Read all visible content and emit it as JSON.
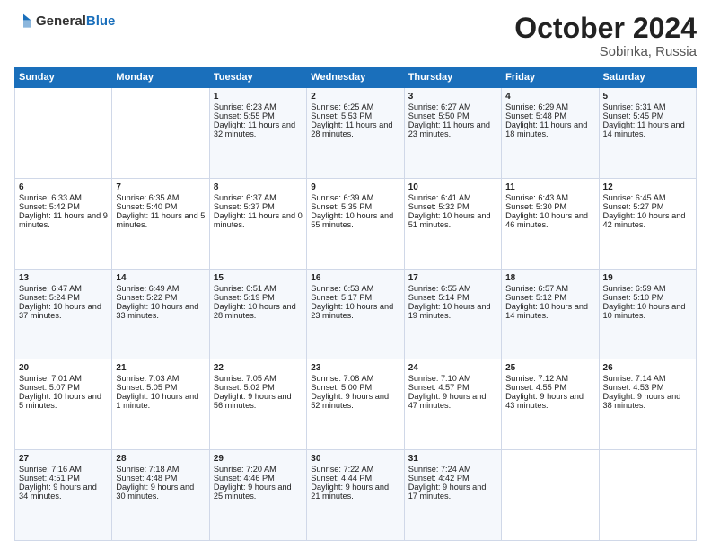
{
  "logo": {
    "general": "General",
    "blue": "Blue"
  },
  "title": {
    "month": "October 2024",
    "location": "Sobinka, Russia"
  },
  "header": {
    "days": [
      "Sunday",
      "Monday",
      "Tuesday",
      "Wednesday",
      "Thursday",
      "Friday",
      "Saturday"
    ]
  },
  "weeks": [
    [
      {
        "day": "",
        "sunrise": "",
        "sunset": "",
        "daylight": ""
      },
      {
        "day": "",
        "sunrise": "",
        "sunset": "",
        "daylight": ""
      },
      {
        "day": "1",
        "sunrise": "Sunrise: 6:23 AM",
        "sunset": "Sunset: 5:55 PM",
        "daylight": "Daylight: 11 hours and 32 minutes."
      },
      {
        "day": "2",
        "sunrise": "Sunrise: 6:25 AM",
        "sunset": "Sunset: 5:53 PM",
        "daylight": "Daylight: 11 hours and 28 minutes."
      },
      {
        "day": "3",
        "sunrise": "Sunrise: 6:27 AM",
        "sunset": "Sunset: 5:50 PM",
        "daylight": "Daylight: 11 hours and 23 minutes."
      },
      {
        "day": "4",
        "sunrise": "Sunrise: 6:29 AM",
        "sunset": "Sunset: 5:48 PM",
        "daylight": "Daylight: 11 hours and 18 minutes."
      },
      {
        "day": "5",
        "sunrise": "Sunrise: 6:31 AM",
        "sunset": "Sunset: 5:45 PM",
        "daylight": "Daylight: 11 hours and 14 minutes."
      }
    ],
    [
      {
        "day": "6",
        "sunrise": "Sunrise: 6:33 AM",
        "sunset": "Sunset: 5:42 PM",
        "daylight": "Daylight: 11 hours and 9 minutes."
      },
      {
        "day": "7",
        "sunrise": "Sunrise: 6:35 AM",
        "sunset": "Sunset: 5:40 PM",
        "daylight": "Daylight: 11 hours and 5 minutes."
      },
      {
        "day": "8",
        "sunrise": "Sunrise: 6:37 AM",
        "sunset": "Sunset: 5:37 PM",
        "daylight": "Daylight: 11 hours and 0 minutes."
      },
      {
        "day": "9",
        "sunrise": "Sunrise: 6:39 AM",
        "sunset": "Sunset: 5:35 PM",
        "daylight": "Daylight: 10 hours and 55 minutes."
      },
      {
        "day": "10",
        "sunrise": "Sunrise: 6:41 AM",
        "sunset": "Sunset: 5:32 PM",
        "daylight": "Daylight: 10 hours and 51 minutes."
      },
      {
        "day": "11",
        "sunrise": "Sunrise: 6:43 AM",
        "sunset": "Sunset: 5:30 PM",
        "daylight": "Daylight: 10 hours and 46 minutes."
      },
      {
        "day": "12",
        "sunrise": "Sunrise: 6:45 AM",
        "sunset": "Sunset: 5:27 PM",
        "daylight": "Daylight: 10 hours and 42 minutes."
      }
    ],
    [
      {
        "day": "13",
        "sunrise": "Sunrise: 6:47 AM",
        "sunset": "Sunset: 5:24 PM",
        "daylight": "Daylight: 10 hours and 37 minutes."
      },
      {
        "day": "14",
        "sunrise": "Sunrise: 6:49 AM",
        "sunset": "Sunset: 5:22 PM",
        "daylight": "Daylight: 10 hours and 33 minutes."
      },
      {
        "day": "15",
        "sunrise": "Sunrise: 6:51 AM",
        "sunset": "Sunset: 5:19 PM",
        "daylight": "Daylight: 10 hours and 28 minutes."
      },
      {
        "day": "16",
        "sunrise": "Sunrise: 6:53 AM",
        "sunset": "Sunset: 5:17 PM",
        "daylight": "Daylight: 10 hours and 23 minutes."
      },
      {
        "day": "17",
        "sunrise": "Sunrise: 6:55 AM",
        "sunset": "Sunset: 5:14 PM",
        "daylight": "Daylight: 10 hours and 19 minutes."
      },
      {
        "day": "18",
        "sunrise": "Sunrise: 6:57 AM",
        "sunset": "Sunset: 5:12 PM",
        "daylight": "Daylight: 10 hours and 14 minutes."
      },
      {
        "day": "19",
        "sunrise": "Sunrise: 6:59 AM",
        "sunset": "Sunset: 5:10 PM",
        "daylight": "Daylight: 10 hours and 10 minutes."
      }
    ],
    [
      {
        "day": "20",
        "sunrise": "Sunrise: 7:01 AM",
        "sunset": "Sunset: 5:07 PM",
        "daylight": "Daylight: 10 hours and 5 minutes."
      },
      {
        "day": "21",
        "sunrise": "Sunrise: 7:03 AM",
        "sunset": "Sunset: 5:05 PM",
        "daylight": "Daylight: 10 hours and 1 minute."
      },
      {
        "day": "22",
        "sunrise": "Sunrise: 7:05 AM",
        "sunset": "Sunset: 5:02 PM",
        "daylight": "Daylight: 9 hours and 56 minutes."
      },
      {
        "day": "23",
        "sunrise": "Sunrise: 7:08 AM",
        "sunset": "Sunset: 5:00 PM",
        "daylight": "Daylight: 9 hours and 52 minutes."
      },
      {
        "day": "24",
        "sunrise": "Sunrise: 7:10 AM",
        "sunset": "Sunset: 4:57 PM",
        "daylight": "Daylight: 9 hours and 47 minutes."
      },
      {
        "day": "25",
        "sunrise": "Sunrise: 7:12 AM",
        "sunset": "Sunset: 4:55 PM",
        "daylight": "Daylight: 9 hours and 43 minutes."
      },
      {
        "day": "26",
        "sunrise": "Sunrise: 7:14 AM",
        "sunset": "Sunset: 4:53 PM",
        "daylight": "Daylight: 9 hours and 38 minutes."
      }
    ],
    [
      {
        "day": "27",
        "sunrise": "Sunrise: 7:16 AM",
        "sunset": "Sunset: 4:51 PM",
        "daylight": "Daylight: 9 hours and 34 minutes."
      },
      {
        "day": "28",
        "sunrise": "Sunrise: 7:18 AM",
        "sunset": "Sunset: 4:48 PM",
        "daylight": "Daylight: 9 hours and 30 minutes."
      },
      {
        "day": "29",
        "sunrise": "Sunrise: 7:20 AM",
        "sunset": "Sunset: 4:46 PM",
        "daylight": "Daylight: 9 hours and 25 minutes."
      },
      {
        "day": "30",
        "sunrise": "Sunrise: 7:22 AM",
        "sunset": "Sunset: 4:44 PM",
        "daylight": "Daylight: 9 hours and 21 minutes."
      },
      {
        "day": "31",
        "sunrise": "Sunrise: 7:24 AM",
        "sunset": "Sunset: 4:42 PM",
        "daylight": "Daylight: 9 hours and 17 minutes."
      },
      {
        "day": "",
        "sunrise": "",
        "sunset": "",
        "daylight": ""
      },
      {
        "day": "",
        "sunrise": "",
        "sunset": "",
        "daylight": ""
      }
    ]
  ]
}
